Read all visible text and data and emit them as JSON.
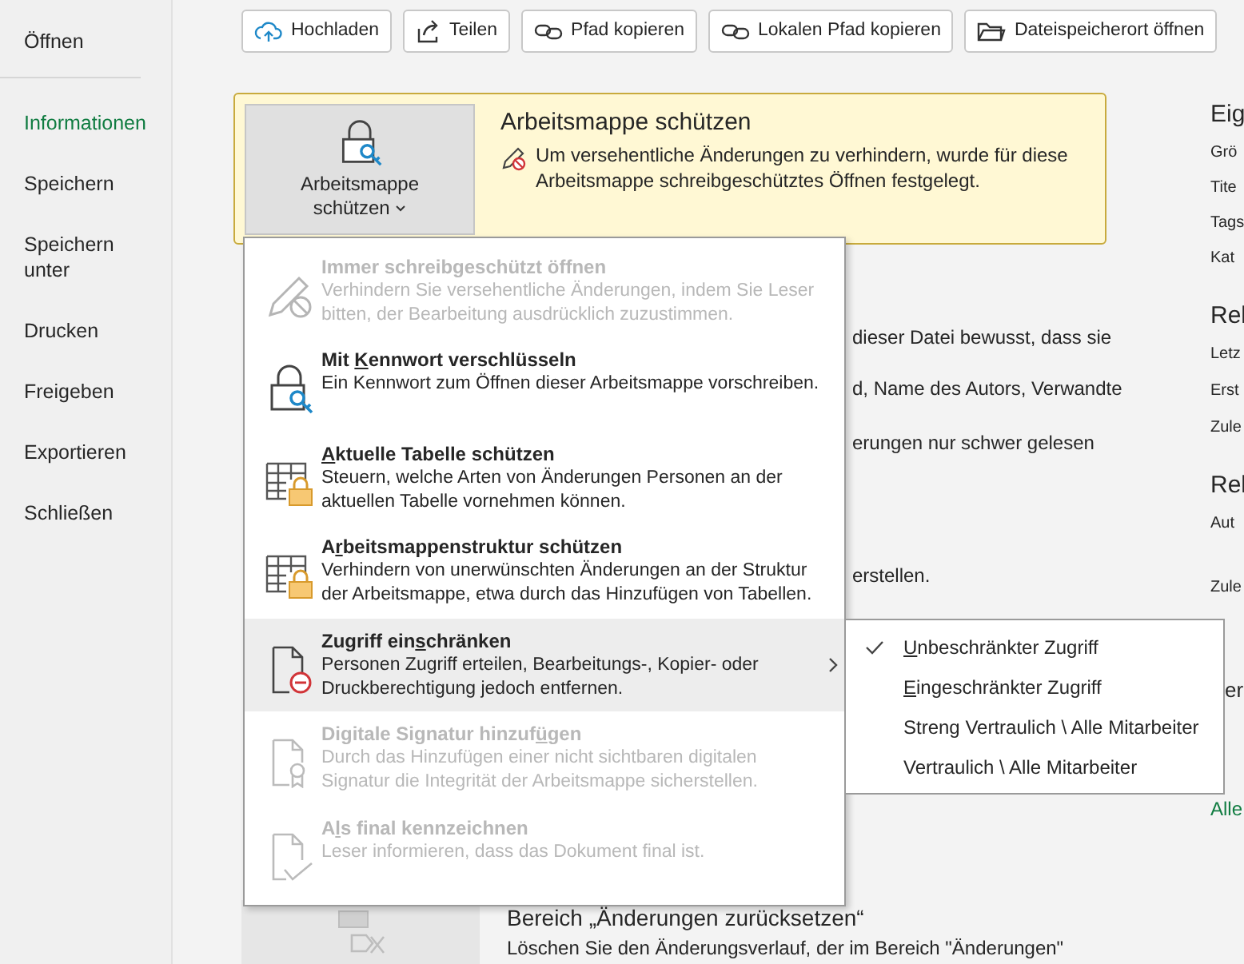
{
  "sidebar": {
    "items": [
      {
        "label": "Öffnen",
        "selected": false
      },
      {
        "label": "Informationen",
        "selected": true
      },
      {
        "label": "Speichern",
        "selected": false
      },
      {
        "label": "Speichern unter",
        "selected": false
      },
      {
        "label": "Drucken",
        "selected": false
      },
      {
        "label": "Freigeben",
        "selected": false
      },
      {
        "label": "Exportieren",
        "selected": false
      },
      {
        "label": "Schließen",
        "selected": false
      }
    ]
  },
  "toolbar": [
    "Hochladen",
    "Teilen",
    "Pfad kopieren",
    "Lokalen Pfad kopieren",
    "Dateispeicherort öffnen"
  ],
  "protect_panel": {
    "button_label": "Arbeitsmappe schützen",
    "title": "Arbeitsmappe schützen",
    "message": "Um versehentliche Änderungen zu verhindern, wurde für diese Arbeitsmappe schreibgeschütztes Öffnen festgelegt."
  },
  "background_lines": [
    "dieser Datei bewusst, dass sie",
    "d, Name des Autors, Verwandte",
    "erungen nur schwer gelesen",
    "erstellen."
  ],
  "reset_section": {
    "title": "Bereich „Änderungen zurücksetzen“",
    "description": "Löschen Sie den Änderungsverlauf, der im Bereich \"Änderungen\""
  },
  "properties_column": [
    {
      "kind": "heading",
      "text": "Eig"
    },
    {
      "kind": "label",
      "text": "Grö"
    },
    {
      "kind": "label",
      "text": "Tite"
    },
    {
      "kind": "label",
      "text": "Tags"
    },
    {
      "kind": "label",
      "text": "Kat"
    },
    {
      "kind": "heading",
      "text": "Rel"
    },
    {
      "kind": "label",
      "text": "Letz"
    },
    {
      "kind": "label",
      "text": "Erst"
    },
    {
      "kind": "label",
      "text": "Zule"
    },
    {
      "kind": "heading",
      "text": "Rel"
    },
    {
      "kind": "label",
      "text": "Aut"
    },
    {
      "kind": "label",
      "text": "Zule"
    },
    {
      "kind": "heading",
      "text": "er"
    },
    {
      "kind": "link",
      "text": "Alle"
    }
  ],
  "protect_menu": {
    "items": [
      {
        "title_before": "Immer schreibgeschützt öffnen",
        "description": "Verhindern Sie versehentliche Änderungen, indem Sie Leser bitten, der Bearbeitung ausdrücklich zuzustimmen.",
        "disabled": true,
        "selected": false,
        "submenu": false
      },
      {
        "title_before": "Mit ",
        "title_key": "K",
        "title_after": "ennwort verschlüsseln",
        "description": "Ein Kennwort zum Öffnen dieser Arbeitsmappe vorschreiben.",
        "disabled": false,
        "selected": false,
        "submenu": false
      },
      {
        "title_key": "A",
        "title_after": "ktuelle Tabelle schützen",
        "description": "Steuern, welche Arten von Änderungen Personen an der aktuellen Tabelle vornehmen können.",
        "disabled": false,
        "selected": false,
        "submenu": false
      },
      {
        "title_before": "A",
        "title_key": "r",
        "title_after": "beitsmappenstruktur schützen",
        "description": "Verhindern von unerwünschten Änderungen an der Struktur der Arbeitsmappe, etwa durch das Hinzufügen von Tabellen.",
        "disabled": false,
        "selected": false,
        "submenu": false
      },
      {
        "title_before": "Zugriff ein",
        "title_key": "s",
        "title_after": "chränken",
        "description": "Personen Zugriff erteilen, Bearbeitungs-, Kopier- oder Druckberechtigung jedoch entfernen.",
        "disabled": false,
        "selected": true,
        "submenu": true
      },
      {
        "title_before": "Digitale Signatur hinzuf",
        "title_key": "ü",
        "title_after": "gen",
        "description": "Durch das Hinzufügen einer nicht sichtbaren digitalen Signatur die Integrität der Arbeitsmappe sicherstellen.",
        "disabled": true,
        "selected": false,
        "submenu": false
      },
      {
        "title_before": "A",
        "title_key": "l",
        "title_after": "s final kennzeichnen",
        "description": "Leser informieren, dass das Dokument final ist.",
        "disabled": true,
        "selected": false,
        "submenu": false
      }
    ]
  },
  "access_submenu": {
    "items": [
      {
        "label_key": "U",
        "label_rest": "nbeschränkter Zugriff",
        "checked": true
      },
      {
        "label_key": "E",
        "label_rest": "ingeschränkter Zugriff",
        "checked": false
      },
      {
        "label_rest": "Streng Vertraulich \\ Alle Mitarbeiter",
        "checked": false
      },
      {
        "label_rest": "Vertraulich \\ Alle Mitarbeiter",
        "checked": false
      }
    ]
  }
}
